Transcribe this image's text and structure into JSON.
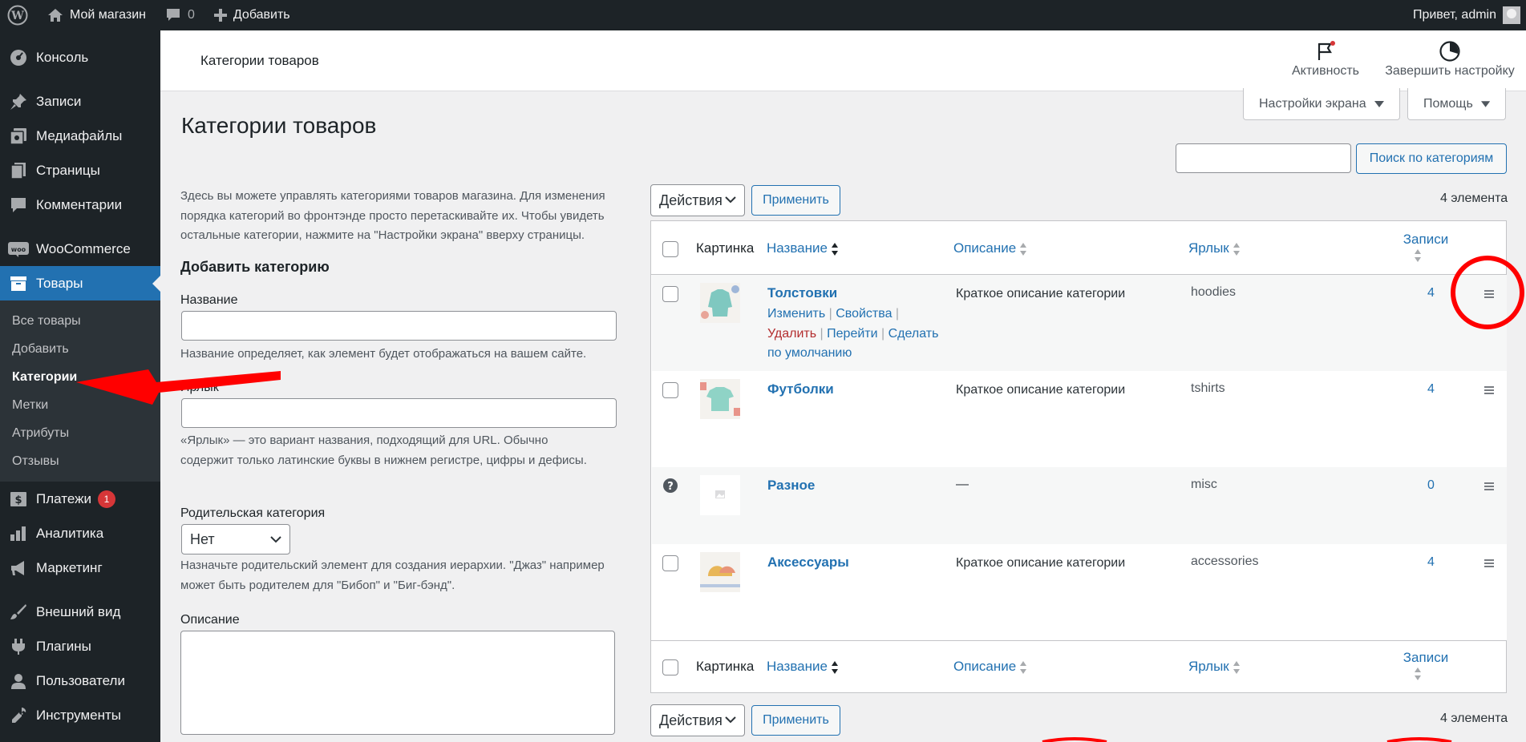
{
  "adminbar": {
    "site_name": "Мой магазин",
    "comments_count": "0",
    "new_label": "Добавить",
    "greeting": "Привет, admin"
  },
  "sidebar": {
    "items_top": [
      {
        "label": "Консоль",
        "icon": "dashboard-icon"
      },
      {
        "label": "Записи",
        "icon": "pin-icon"
      },
      {
        "label": "Медиафайлы",
        "icon": "media-icon"
      },
      {
        "label": "Страницы",
        "icon": "pages-icon"
      },
      {
        "label": "Комментарии",
        "icon": "comments-icon"
      },
      {
        "label": "WooCommerce",
        "icon": "woocommerce-icon"
      },
      {
        "label": "Товары",
        "icon": "archive-icon"
      }
    ],
    "submenu": [
      "Все товары",
      "Добавить",
      "Категории",
      "Метки",
      "Атрибуты",
      "Отзывы"
    ],
    "items_bottom": [
      {
        "label": "Платежи",
        "icon": "dollar-icon",
        "badge": "1"
      },
      {
        "label": "Аналитика",
        "icon": "chart-icon"
      },
      {
        "label": "Маркетинг",
        "icon": "megaphone-icon"
      },
      {
        "label": "Внешний вид",
        "icon": "brush-icon"
      },
      {
        "label": "Плагины",
        "icon": "plugin-icon"
      },
      {
        "label": "Пользователи",
        "icon": "users-icon"
      },
      {
        "label": "Инструменты",
        "icon": "tools-icon"
      }
    ]
  },
  "topbar": {
    "title": "Категории товаров",
    "activity_label": "Активность",
    "finish_setup_label": "Завершить настройку"
  },
  "screen_options_label": "Настройки экрана",
  "help_label": "Помощь",
  "page_title": "Категории товаров",
  "search": {
    "value": "",
    "button_label": "Поиск по категориям"
  },
  "form": {
    "intro": "Здесь вы можете управлять категориями товаров магазина. Для изменения порядка категорий во фронтэнде просто перетаскивайте их. Чтобы увидеть остальные категории, нажмите на \"Настройки экрана\" вверху страницы.",
    "heading": "Добавить категорию",
    "name_label": "Название",
    "name_help": "Название определяет, как элемент будет отображаться на вашем сайте.",
    "slug_label": "Ярлык",
    "slug_help": "«Ярлык» — это вариант названия, подходящий для URL. Обычно содержит только латинские буквы в нижнем регистре, цифры и дефисы.",
    "parent_label": "Родительская категория",
    "parent_value": "Нет",
    "parent_help": "Назначьте родительский элемент для создания иерархии. \"Джаз\" например может быть родителем для \"Бибоп\" и \"Биг-бэнд\".",
    "desc_label": "Описание"
  },
  "bulk": {
    "select_label": "Действия",
    "apply_label": "Применить",
    "count_label": "4 элемента"
  },
  "table": {
    "headers": {
      "image": "Картинка",
      "name": "Название",
      "description": "Описание",
      "slug": "Ярлык",
      "count": "Записи"
    },
    "rows": [
      {
        "name": "Толстовки",
        "description": "Краткое описание категории",
        "slug": "hoodies",
        "count": "4"
      },
      {
        "name": "Футболки",
        "description": "Краткое описание категории",
        "slug": "tshirts",
        "count": "4"
      },
      {
        "name": "Разное",
        "description": "—",
        "slug": "misc",
        "count": "0"
      },
      {
        "name": "Аксессуары",
        "description": "Краткое описание категории",
        "slug": "accessories",
        "count": "4"
      }
    ],
    "row_actions": {
      "edit": "Изменить",
      "properties": "Свойства",
      "delete": "Удалить",
      "view": "Перейти",
      "make_default": "Сделать по умолчанию"
    }
  },
  "colors": {
    "accent": "#2271b1",
    "admin_bg": "#1d2327",
    "annotation": "#ff0000"
  }
}
